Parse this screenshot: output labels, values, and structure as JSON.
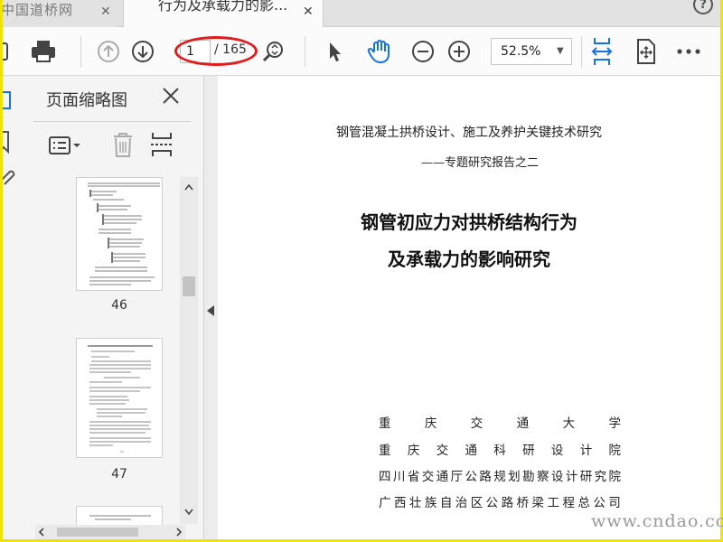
{
  "tabs": {
    "previous_title": "中国道桥网",
    "active_title": "行为及承载力的影...",
    "close_glyph": "✕",
    "help_glyph": "?"
  },
  "toolbar": {
    "current_page": "1",
    "page_total": "/ 165",
    "zoom": "52.5%"
  },
  "thumbnail_panel": {
    "title": "页面缩略图",
    "thumbnails": [
      {
        "label": "46"
      },
      {
        "label": "47"
      }
    ]
  },
  "document": {
    "subject": "钢管混凝土拱桥设计、施工及养护关键技术研究",
    "series": "——专题研究报告之二",
    "title_line1": "钢管初应力对拱桥结构行为",
    "title_line2": "及承载力的影响研究",
    "organizations": [
      "重庆交通大学",
      "重庆交通科研设计院",
      "四川省交通厅公路规划勘察设计研究院",
      "广西壮族自治区公路桥梁工程总公司"
    ]
  },
  "watermark": "www.cndao.com",
  "colors": {
    "frame": "#f0e500",
    "highlight_circle": "#e01c1c",
    "hand_tool": "#1473e6"
  }
}
